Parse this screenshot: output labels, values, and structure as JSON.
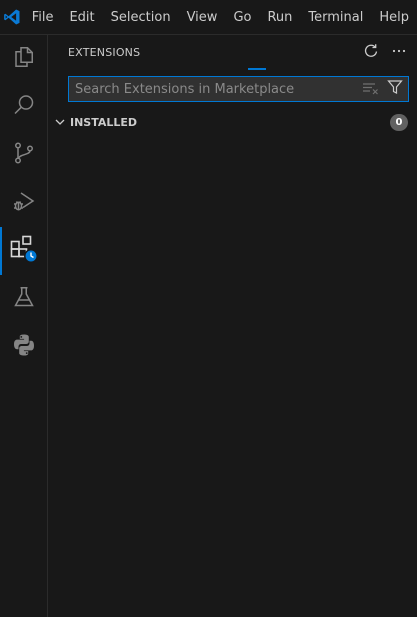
{
  "titlebar": {
    "menu": [
      "File",
      "Edit",
      "Selection",
      "View",
      "Go",
      "Run",
      "Terminal",
      "Help"
    ]
  },
  "activitybar": {
    "items": [
      {
        "icon": "explorer-icon",
        "active": false
      },
      {
        "icon": "search-icon",
        "active": false
      },
      {
        "icon": "source-control-icon",
        "active": false
      },
      {
        "icon": "run-debug-icon",
        "active": false
      },
      {
        "icon": "extensions-icon",
        "active": true
      },
      {
        "icon": "testing-icon",
        "active": false
      },
      {
        "icon": "python-icon",
        "active": false
      }
    ]
  },
  "sidebar": {
    "title": "EXTENSIONS",
    "search": {
      "placeholder": "Search Extensions in Marketplace",
      "value": ""
    },
    "installed": {
      "title": "INSTALLED",
      "count": "0"
    }
  },
  "colors": {
    "accent": "#0078d4",
    "background": "#181818",
    "input_bg": "#313131",
    "badge_bg": "#616161"
  }
}
